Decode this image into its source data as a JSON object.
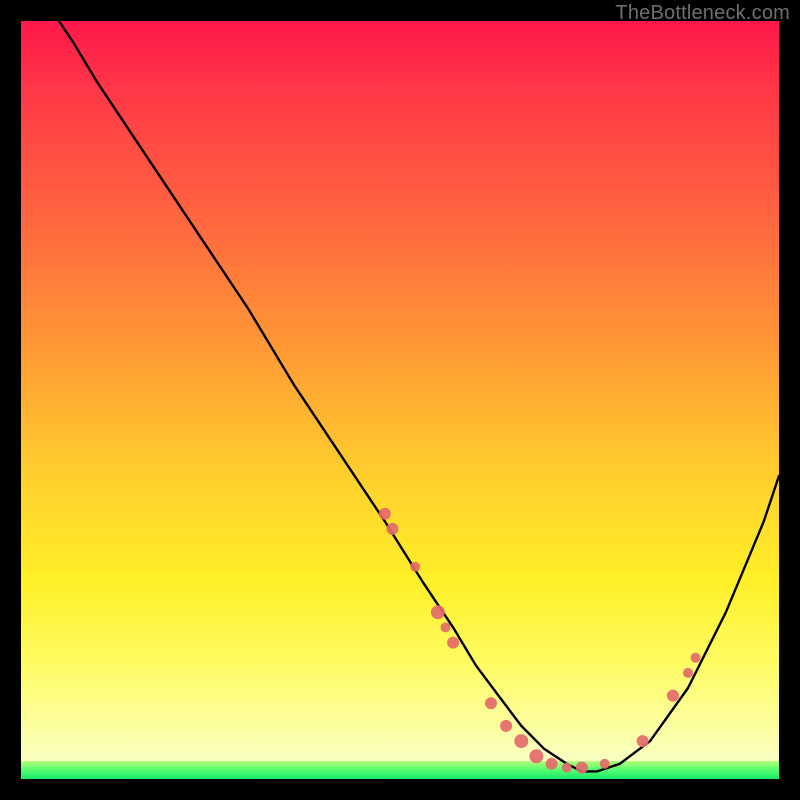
{
  "watermark": "TheBottleneck.com",
  "chart_data": {
    "type": "line",
    "title": "",
    "xlabel": "",
    "ylabel": "",
    "xlim": [
      0,
      100
    ],
    "ylim": [
      0,
      100
    ],
    "grid": false,
    "series": [
      {
        "name": "bottleneck-curve",
        "color": "#000000",
        "x": [
          5,
          7,
          10,
          14,
          18,
          24,
          30,
          36,
          42,
          48,
          53,
          57,
          60,
          63,
          66,
          69,
          72,
          74,
          76,
          79,
          83,
          88,
          93,
          98,
          100
        ],
        "values": [
          100,
          97,
          92,
          86,
          80,
          71,
          62,
          52,
          43,
          34,
          26,
          20,
          15,
          11,
          7,
          4,
          2,
          1,
          1,
          2,
          5,
          12,
          22,
          34,
          40
        ]
      }
    ],
    "markers": {
      "name": "highlighted-points",
      "color": "#e46a6a",
      "points": [
        {
          "x": 48,
          "y": 35,
          "r": 6
        },
        {
          "x": 49,
          "y": 33,
          "r": 6
        },
        {
          "x": 52,
          "y": 28,
          "r": 5
        },
        {
          "x": 55,
          "y": 22,
          "r": 7
        },
        {
          "x": 56,
          "y": 20,
          "r": 5
        },
        {
          "x": 57,
          "y": 18,
          "r": 6
        },
        {
          "x": 62,
          "y": 10,
          "r": 6
        },
        {
          "x": 64,
          "y": 7,
          "r": 6
        },
        {
          "x": 66,
          "y": 5,
          "r": 7
        },
        {
          "x": 68,
          "y": 3,
          "r": 7
        },
        {
          "x": 70,
          "y": 2,
          "r": 6
        },
        {
          "x": 72,
          "y": 1.5,
          "r": 5
        },
        {
          "x": 74,
          "y": 1.5,
          "r": 6
        },
        {
          "x": 77,
          "y": 2,
          "r": 5
        },
        {
          "x": 82,
          "y": 5,
          "r": 6
        },
        {
          "x": 86,
          "y": 11,
          "r": 6
        },
        {
          "x": 88,
          "y": 14,
          "r": 5
        },
        {
          "x": 89,
          "y": 16,
          "r": 5
        }
      ]
    },
    "colors": {
      "gradient_top": "#ff184b",
      "gradient_bottom": "#f8ffd2",
      "accent_green": "#16e86c",
      "curve": "#000000",
      "marker": "#e46a6a",
      "frame": "#000000"
    }
  }
}
